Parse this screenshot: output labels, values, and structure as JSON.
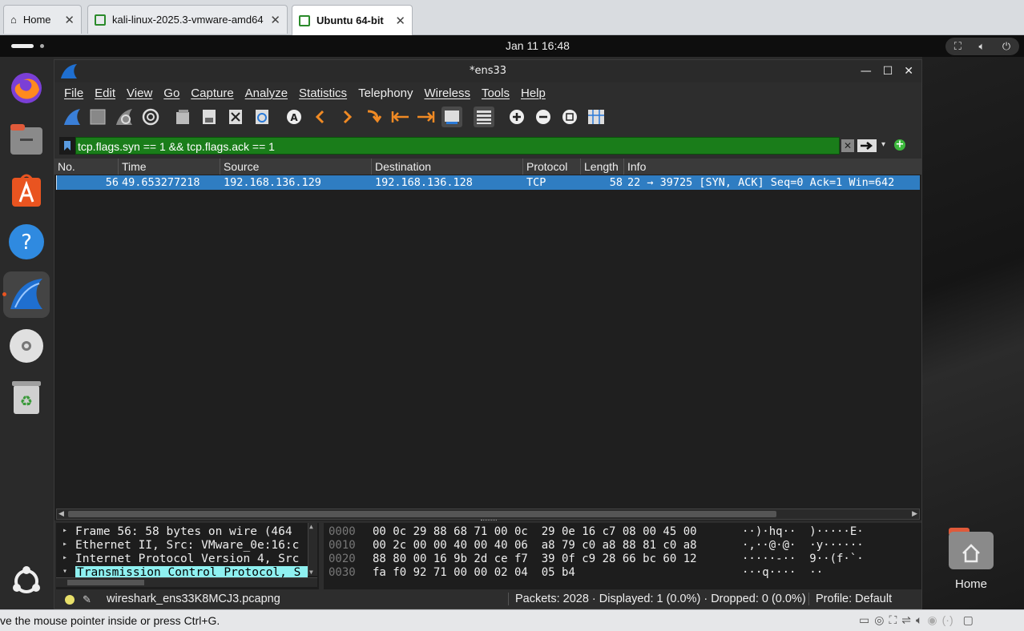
{
  "vm_tabs": [
    {
      "label": "Home"
    },
    {
      "label": "kali-linux-2025.3-vmware-amd64"
    },
    {
      "label": "Ubuntu 64-bit"
    }
  ],
  "topbar": {
    "clock": "Jan 11  16:48"
  },
  "desktop": {
    "home_label": "Home"
  },
  "window": {
    "title": "*ens33"
  },
  "menu": [
    "File",
    "Edit",
    "View",
    "Go",
    "Capture",
    "Analyze",
    "Statistics",
    "Telephony",
    "Wireless",
    "Tools",
    "Help"
  ],
  "filter": {
    "value": "tcp.flags.syn == 1 && tcp.flags.ack == 1",
    "bg_color": "#1a7d1a"
  },
  "columns": [
    "No.",
    "Time",
    "Source",
    "Destination",
    "Protocol",
    "Length",
    "Info"
  ],
  "packet": {
    "no": "56",
    "time": "49.653277218",
    "source": "192.168.136.129",
    "destination": "192.168.136.128",
    "protocol": "TCP",
    "length": "58",
    "info": "22 → 39725 [SYN, ACK] Seq=0 Ack=1 Win=642"
  },
  "details": [
    "Frame 56: 58 bytes on wire (464",
    "Ethernet II, Src: VMware_0e:16:c",
    "Internet Protocol Version 4, Src",
    "Transmission Control Protocol, S"
  ],
  "hex": [
    {
      "offset": "0000",
      "bytes": "00 0c 29 88 68 71 00 0c  29 0e 16 c7 08 00 45 00",
      "ascii": "··)·hq··  )·····E·"
    },
    {
      "offset": "0010",
      "bytes": "00 2c 00 00 40 00 40 06  a8 79 c0 a8 88 81 c0 a8",
      "ascii": "·,··@·@·  ·y······"
    },
    {
      "offset": "0020",
      "bytes": "88 80 00 16 9b 2d ce f7  39 0f c9 28 66 bc 60 12",
      "ascii": "·····-··  9··(f·`·"
    },
    {
      "offset": "0030",
      "bytes": "fa f0 92 71 00 00 02 04  05 b4",
      "ascii": "···q····  ··"
    }
  ],
  "status": {
    "file": "wireshark_ens33K8MCJ3.pcapng",
    "counts": "Packets: 2028 · Displayed: 1 (0.0%) · Dropped: 0 (0.0%)",
    "profile": "Profile: Default"
  },
  "vm_status": {
    "hint": "ve the mouse pointer inside or press Ctrl+G."
  }
}
